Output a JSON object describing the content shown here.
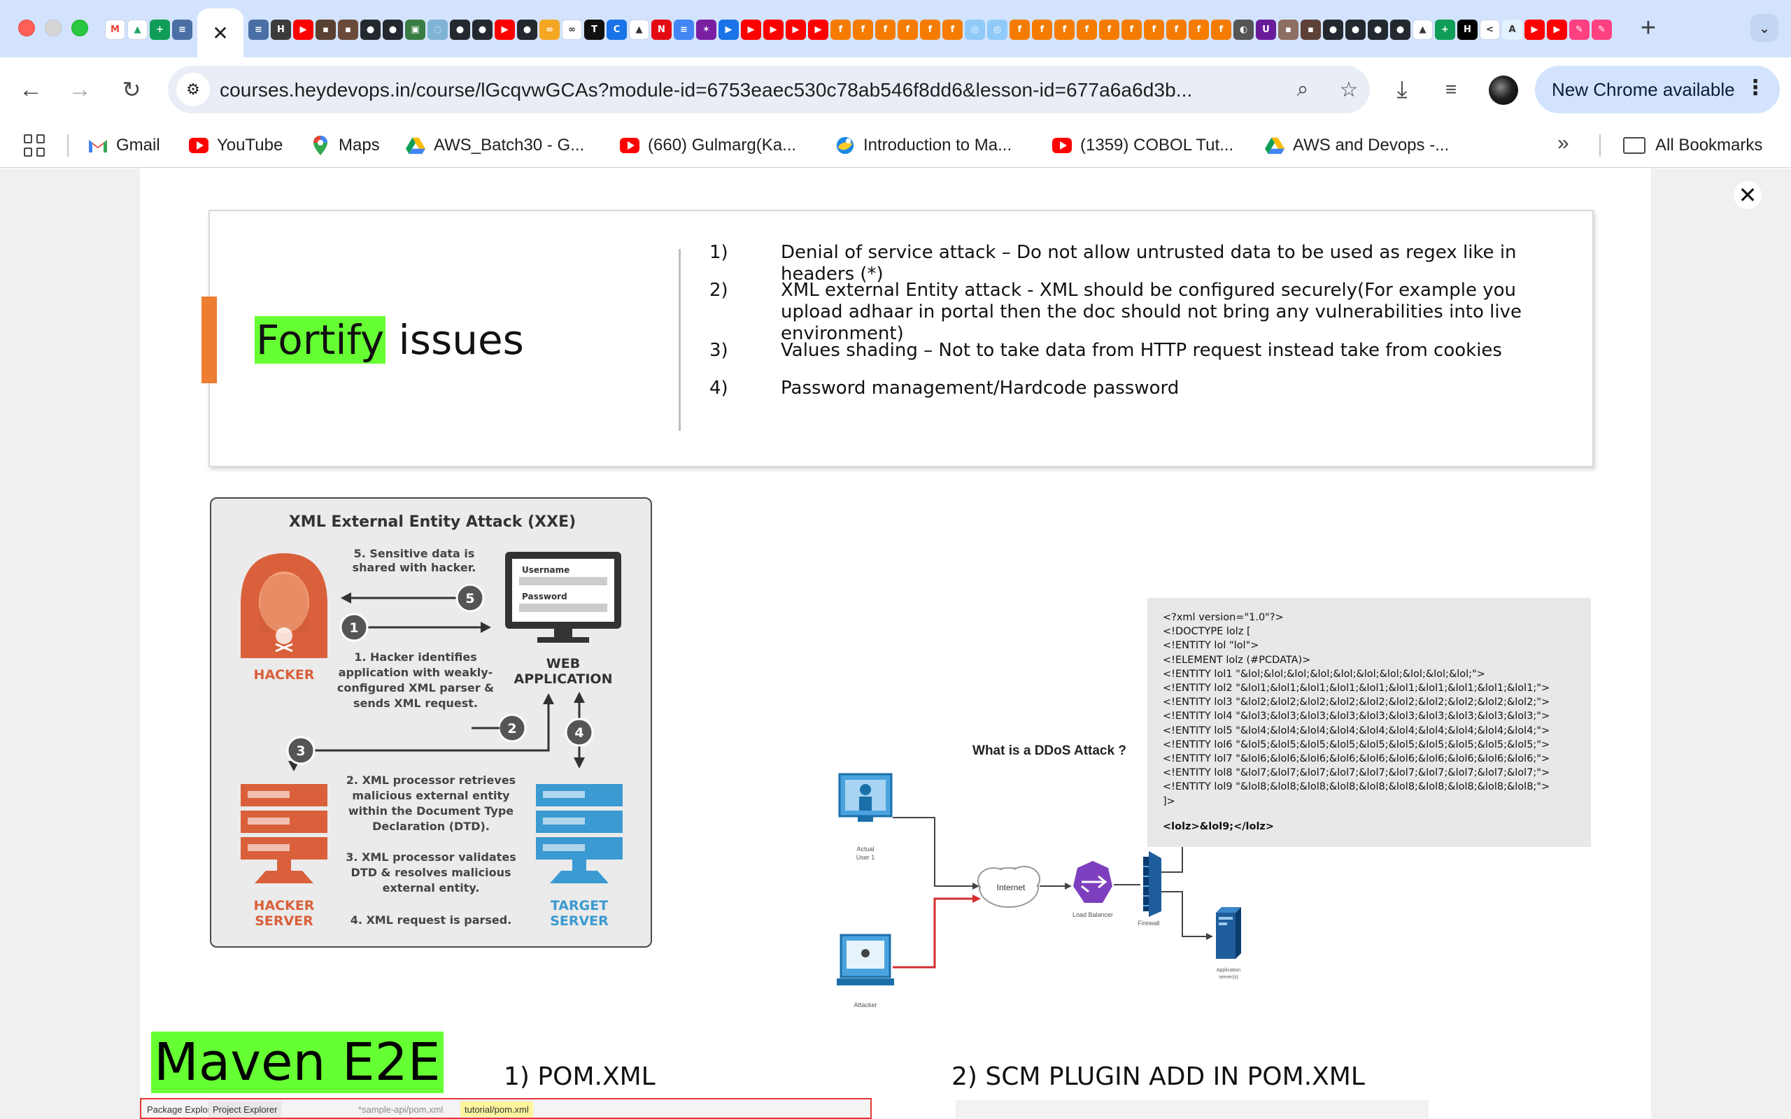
{
  "browser": {
    "tabs_favicons": [
      {
        "name": "gmail-favicon",
        "glyph": "M",
        "bg": "#ffffff",
        "fg": "#ea4335"
      },
      {
        "name": "drive-favicon",
        "glyph": "▲",
        "bg": "#ffffff",
        "fg": "#1fa463"
      },
      {
        "name": "sheets-favicon",
        "glyph": "+",
        "bg": "#0f9d58",
        "fg": "#ffffff"
      },
      {
        "name": "doc-favicon",
        "glyph": "≡",
        "bg": "#4a6fa5",
        "fg": "#ffffff"
      }
    ],
    "tabs_favicons_after": [
      {
        "glyph": "≡",
        "bg": "#4a6fa5"
      },
      {
        "glyph": "H",
        "bg": "#3b3b3b"
      },
      {
        "glyph": "▶",
        "bg": "#ff0000"
      },
      {
        "glyph": "▪",
        "bg": "#5a4030"
      },
      {
        "glyph": "▪",
        "bg": "#6b4a3a"
      },
      {
        "glyph": "●",
        "bg": "#24292f"
      },
      {
        "glyph": "●",
        "bg": "#24292f"
      },
      {
        "glyph": "▣",
        "bg": "#3a7d44"
      },
      {
        "glyph": "◌",
        "bg": "#7fb3d5"
      },
      {
        "glyph": "●",
        "bg": "#24292f"
      },
      {
        "glyph": "●",
        "bg": "#24292f"
      },
      {
        "glyph": "▶",
        "bg": "#ff0000"
      },
      {
        "glyph": "●",
        "bg": "#24292f"
      },
      {
        "glyph": "∞",
        "bg": "#f5a623"
      },
      {
        "glyph": "∞",
        "bg": "#ffffff"
      },
      {
        "glyph": "T",
        "bg": "#111111"
      },
      {
        "glyph": "C",
        "bg": "#1a73e8"
      },
      {
        "glyph": "▲",
        "bg": "#ffffff"
      },
      {
        "glyph": "N",
        "bg": "#e50914"
      },
      {
        "glyph": "≡",
        "bg": "#4285f4"
      },
      {
        "glyph": "✶",
        "bg": "#7b1fa2"
      },
      {
        "glyph": "▶",
        "bg": "#1a73e8"
      },
      {
        "glyph": "▶",
        "bg": "#ff0000"
      },
      {
        "glyph": "▶",
        "bg": "#ff0000"
      },
      {
        "glyph": "▶",
        "bg": "#ff0000"
      },
      {
        "glyph": "▶",
        "bg": "#ff0000"
      },
      {
        "glyph": "f",
        "bg": "#f57c00"
      },
      {
        "glyph": "f",
        "bg": "#f57c00"
      },
      {
        "glyph": "f",
        "bg": "#f57c00"
      },
      {
        "glyph": "f",
        "bg": "#f57c00"
      },
      {
        "glyph": "f",
        "bg": "#f57c00"
      },
      {
        "glyph": "f",
        "bg": "#f57c00"
      },
      {
        "glyph": "◎",
        "bg": "#90caf9"
      },
      {
        "glyph": "◎",
        "bg": "#90caf9"
      },
      {
        "glyph": "f",
        "bg": "#f57c00"
      },
      {
        "glyph": "f",
        "bg": "#f57c00"
      },
      {
        "glyph": "f",
        "bg": "#f57c00"
      },
      {
        "glyph": "f",
        "bg": "#f57c00"
      },
      {
        "glyph": "f",
        "bg": "#f57c00"
      },
      {
        "glyph": "f",
        "bg": "#f57c00"
      },
      {
        "glyph": "f",
        "bg": "#f57c00"
      },
      {
        "glyph": "f",
        "bg": "#f57c00"
      },
      {
        "glyph": "f",
        "bg": "#f57c00"
      },
      {
        "glyph": "f",
        "bg": "#f57c00"
      },
      {
        "glyph": "◐",
        "bg": "#555555"
      },
      {
        "glyph": "U",
        "bg": "#6a1b9a"
      },
      {
        "glyph": "▪",
        "bg": "#8d6e63"
      },
      {
        "glyph": "▪",
        "bg": "#5d4037"
      },
      {
        "glyph": "●",
        "bg": "#24292f"
      },
      {
        "glyph": "●",
        "bg": "#24292f"
      },
      {
        "glyph": "●",
        "bg": "#24292f"
      },
      {
        "glyph": "●",
        "bg": "#24292f"
      },
      {
        "glyph": "▲",
        "bg": "#ffffff"
      },
      {
        "glyph": "+",
        "bg": "#0f9d58"
      },
      {
        "glyph": "H",
        "bg": "#000000"
      },
      {
        "glyph": "<",
        "bg": "#ffffff"
      },
      {
        "glyph": "A",
        "bg": "#e3f2fd"
      },
      {
        "glyph": "▶",
        "bg": "#ff0000"
      },
      {
        "glyph": "▶",
        "bg": "#ff0000"
      },
      {
        "glyph": "✎",
        "bg": "#ff4081"
      },
      {
        "glyph": "✎",
        "bg": "#ff4081"
      }
    ],
    "url": "courses.heydevops.in/course/lGcqvwGCAs?module-id=6753eaec530c78ab546f8dd6&lesson-id=677a6a6d3b...",
    "new_chrome_label": "New Chrome available",
    "bookmarks": [
      {
        "label": "Gmail",
        "icon": "gmail-icon"
      },
      {
        "label": "YouTube",
        "icon": "youtube-icon"
      },
      {
        "label": "Maps",
        "icon": "maps-icon"
      },
      {
        "label": "AWS_Batch30 - G...",
        "icon": "drive-icon"
      },
      {
        "label": "(660) Gulmarg(Ka...",
        "icon": "youtube-icon"
      },
      {
        "label": "Introduction to Ma...",
        "icon": "course-icon"
      },
      {
        "label": "(1359) COBOL Tut...",
        "icon": "youtube-icon"
      },
      {
        "label": "AWS and Devops -...",
        "icon": "drive-icon"
      }
    ],
    "all_bookmarks_label": "All Bookmarks",
    "colors": {
      "tabstrip": "#d3e3fd",
      "omnibox": "#e9eef6",
      "accent_green": "#66ff33",
      "slide_accent": "#ed7d31"
    }
  },
  "slide1": {
    "title_highlight": "Fortify",
    "title_rest": " issues",
    "issues": [
      {
        "num": "1)",
        "text": "Denial of service attack – Do not allow untrusted data to be used as regex like in headers (*)"
      },
      {
        "num": "2)",
        "text": "XML external Entity attack - XML should be configured securely(For example you upload adhaar in portal then the doc should not bring any vulnerabilities into live environment)"
      },
      {
        "num": "3)",
        "text": "Values shading – Not to take data from HTTP request instead take from cookies"
      },
      {
        "num": "4)",
        "text": "Password management/Hardcode password"
      }
    ]
  },
  "xxe": {
    "title": "XML External Entity Attack (XXE)",
    "step5": [
      "5. Sensitive data is",
      "shared with hacker."
    ],
    "step1": [
      "1. Hacker identifies",
      "application with weakly-",
      "configured XML parser &",
      "sends XML request."
    ],
    "step2": [
      "2. XML processor retrieves",
      "malicious external entity",
      "within the Document Type",
      "Declaration (DTD)."
    ],
    "step3": [
      "3. XML processor validates",
      "DTD & resolves malicious",
      "external entity."
    ],
    "step4": "4. XML request is parsed.",
    "hacker_label": "HACKER",
    "web_app_label": [
      "WEB",
      "APPLICATION"
    ],
    "hacker_server_label": [
      "HACKER",
      "SERVER"
    ],
    "target_server_label": [
      "TARGET",
      "SERVER"
    ],
    "username_label": "Username",
    "password_label": "Password",
    "badges": [
      "1",
      "2",
      "3",
      "4",
      "5"
    ]
  },
  "ddos": {
    "title": "What is a DDoS Attack ?",
    "actual_user_label": [
      "Actual",
      "User 1"
    ],
    "attacker_label": "Attacker",
    "internet_label": "Internet",
    "load_balancer_label": "Load Balancer",
    "firewall_label": "Firewall",
    "app_server_label": [
      "Application",
      "server(s)"
    ]
  },
  "xml_code": {
    "lines": [
      "<?xml version=\"1.0\"?>",
      "<!DOCTYPE lolz [",
      " <!ENTITY lol \"lol\">",
      " <!ELEMENT lolz (#PCDATA)>",
      " <!ENTITY lol1 \"&lol;&lol;&lol;&lol;&lol;&lol;&lol;&lol;&lol;&lol;\">",
      " <!ENTITY lol2 \"&lol1;&lol1;&lol1;&lol1;&lol1;&lol1;&lol1;&lol1;&lol1;&lol1;\">",
      " <!ENTITY lol3 \"&lol2;&lol2;&lol2;&lol2;&lol2;&lol2;&lol2;&lol2;&lol2;&lol2;\">",
      " <!ENTITY lol4 \"&lol3;&lol3;&lol3;&lol3;&lol3;&lol3;&lol3;&lol3;&lol3;&lol3;\">",
      " <!ENTITY lol5 \"&lol4;&lol4;&lol4;&lol4;&lol4;&lol4;&lol4;&lol4;&lol4;&lol4;\">",
      " <!ENTITY lol6 \"&lol5;&lol5;&lol5;&lol5;&lol5;&lol5;&lol5;&lol5;&lol5;&lol5;\">",
      " <!ENTITY lol7 \"&lol6;&lol6;&lol6;&lol6;&lol6;&lol6;&lol6;&lol6;&lol6;&lol6;\">",
      " <!ENTITY lol8 \"&lol7;&lol7;&lol7;&lol7;&lol7;&lol7;&lol7;&lol7;&lol7;&lol7;\">",
      " <!ENTITY lol9 \"&lol8;&lol8;&lol8;&lol8;&lol8;&lol8;&lol8;&lol8;&lol8;&lol8;\">",
      "]>"
    ],
    "payload": "<lolz>&lol9;</lolz>"
  },
  "bottom": {
    "maven_title": "Maven E2E",
    "pom_title": "1) POM.XML",
    "scm_title": "2) SCM PLUGIN ADD IN POM.XML",
    "eclipse_tabs": [
      "Package Explorer",
      "Project Explorer",
      "*sample-api/pom.xml",
      "tutorial/pom.xml"
    ]
  }
}
